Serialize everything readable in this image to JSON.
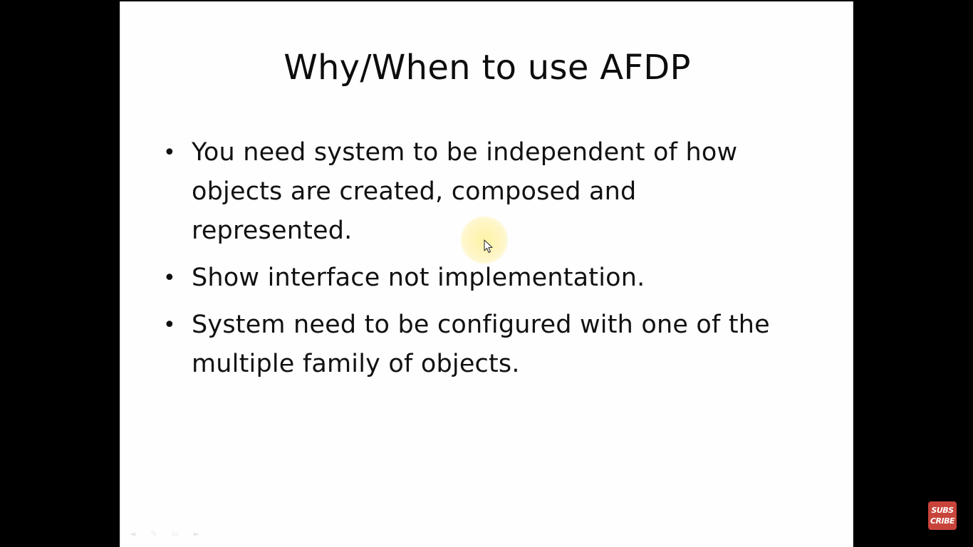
{
  "slide": {
    "title": "Why/When to use AFDP",
    "bullets": [
      "You need system to be independent of how objects are created, composed and represented.",
      "Show interface not implementation.",
      "System need to be configured with one of the multiple family of objects."
    ],
    "bullet_symbol": "•"
  },
  "watermark": {
    "line1": "SUBS",
    "line2": "CRIBE",
    "color": "#c8443b"
  },
  "colors": {
    "background": "#000000",
    "slide_background": "#fefefe",
    "text": "#111111",
    "cursor_highlight": "#fff09a"
  },
  "icons": {
    "cursor": "mouse-pointer-icon",
    "nav": [
      "slide-prev-icon",
      "slide-pen-icon",
      "slide-menu-icon",
      "slide-next-icon"
    ]
  }
}
